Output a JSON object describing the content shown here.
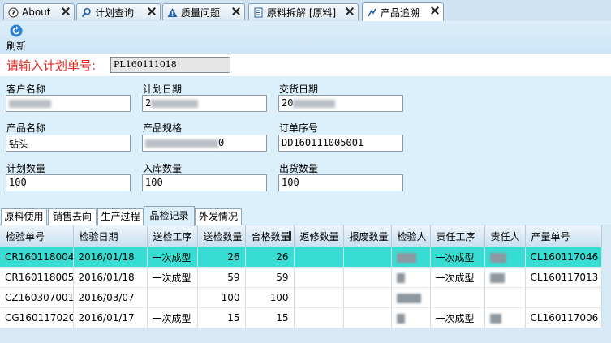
{
  "doc_tabs": [
    {
      "label": "About",
      "icon": "help-icon",
      "active": false
    },
    {
      "label": "计划查询",
      "icon": "search-icon",
      "active": false
    },
    {
      "label": "质量问题",
      "icon": "warning-icon",
      "active": false
    },
    {
      "label": "原料拆解 [原料]",
      "icon": "document-icon",
      "active": false
    },
    {
      "label": "产品追溯",
      "icon": "trace-icon",
      "active": true
    }
  ],
  "toolbar": {
    "refresh_label": "刷新",
    "refresh_icon": "refresh-icon"
  },
  "plan": {
    "label": "请输入计划单号:",
    "value": "PL160111018"
  },
  "fields": {
    "customer_name": {
      "label": "客户名称",
      "value": ""
    },
    "plan_date": {
      "label": "计划日期",
      "value": "2"
    },
    "delivery_date": {
      "label": "交货日期",
      "value": "20"
    },
    "product_name": {
      "label": "产品名称",
      "value": "钻头"
    },
    "product_spec": {
      "label": "产品规格",
      "value": "0"
    },
    "order_seq": {
      "label": "订单序号",
      "value": "DD160111005001"
    },
    "plan_qty": {
      "label": "计划数量",
      "value": "100"
    },
    "stock_in_qty": {
      "label": "入库数量",
      "value": "100"
    },
    "ship_qty": {
      "label": "出货数量",
      "value": "100"
    }
  },
  "record_tabs": [
    "原料使用",
    "销售去向",
    "生产过程",
    "品检记录",
    "外发情况"
  ],
  "active_record_tab": "品检记录",
  "grid": {
    "columns": [
      "检验单号",
      "检验日期",
      "送检工序",
      "送检数量",
      "合格数量",
      "返修数量",
      "报废数量",
      "检验人",
      "责任工序",
      "责任人",
      "产量单号"
    ],
    "rows": [
      [
        "CR160118004",
        "2016/01/18",
        "一次成型",
        "26",
        "26",
        "",
        "",
        "",
        "一次成型",
        "",
        "CL160117046"
      ],
      [
        "CR160118005",
        "2016/01/18",
        "一次成型",
        "59",
        "59",
        "",
        "",
        "",
        "一次成型",
        "",
        "CL160117013"
      ],
      [
        "CZ160307001",
        "2016/03/07",
        "",
        "100",
        "100",
        "",
        "",
        "",
        "",
        "",
        ""
      ],
      [
        "CG160117020",
        "2016/01/17",
        "一次成型",
        "15",
        "15",
        "",
        "",
        "",
        "一次成型",
        "",
        "CL160117006"
      ]
    ],
    "selected_row": 0
  }
}
